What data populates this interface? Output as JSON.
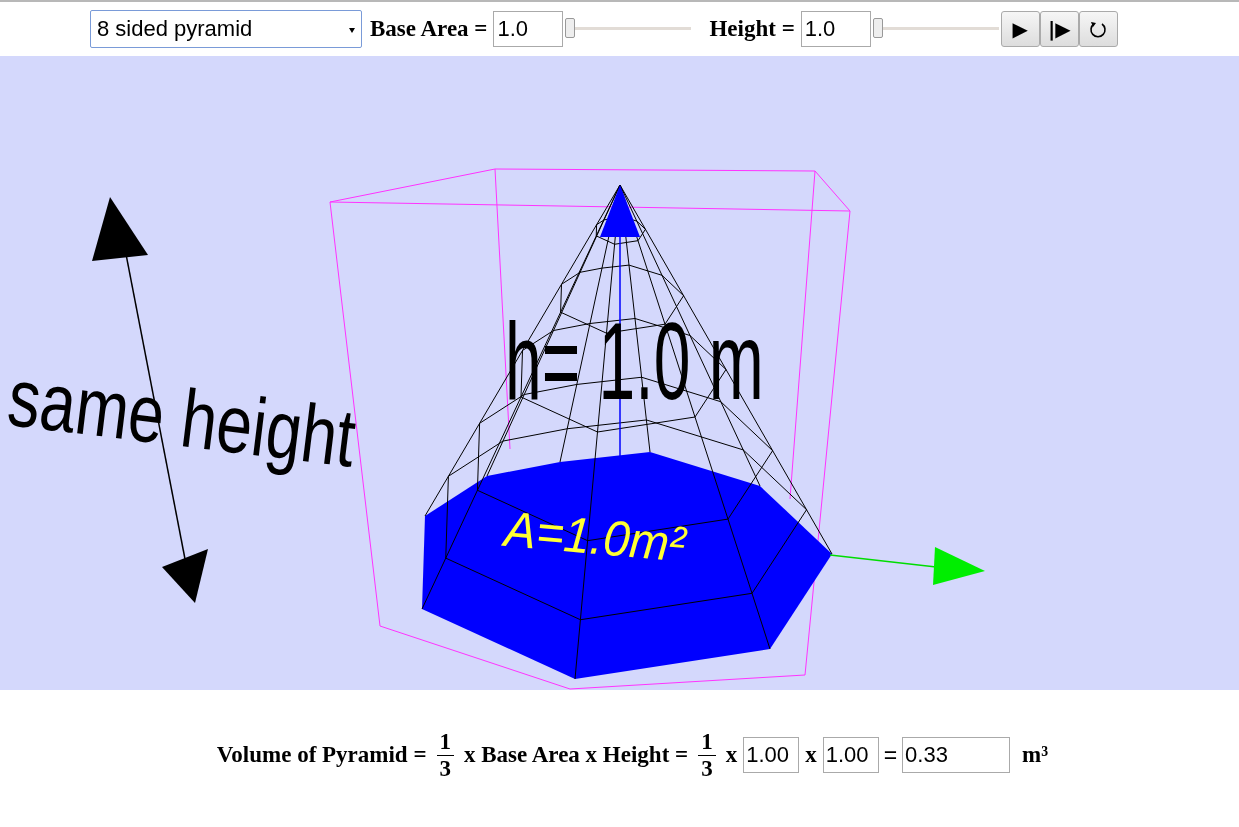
{
  "controls": {
    "shape_select": {
      "value": "8 sided pyramid"
    },
    "base_area": {
      "label": "Base Area =",
      "value": "1.0",
      "level": 0
    },
    "height": {
      "label": "Height =",
      "value": "1.0",
      "level": 0
    },
    "buttons": [
      {
        "kind": "play",
        "label": "▶"
      },
      {
        "kind": "step",
        "label": "|▶"
      },
      {
        "kind": "reset"
      }
    ]
  },
  "scene": {
    "side_label": "same height",
    "height_label": "h= 1.0 m",
    "area_label": "A=1.0m²"
  },
  "formula": {
    "lead": "Volume of Pyramid =",
    "fraction_1": {
      "numerator": "1",
      "denominator": "3"
    },
    "middle": "x Base Area x Height =",
    "fraction_2": {
      "numerator": "1",
      "denominator": "3"
    },
    "times_1": "x",
    "base_area_value": "1.00",
    "times_2": "x",
    "height_value": "1.00",
    "equals": "=",
    "result": "0.33",
    "unit": "m³"
  }
}
